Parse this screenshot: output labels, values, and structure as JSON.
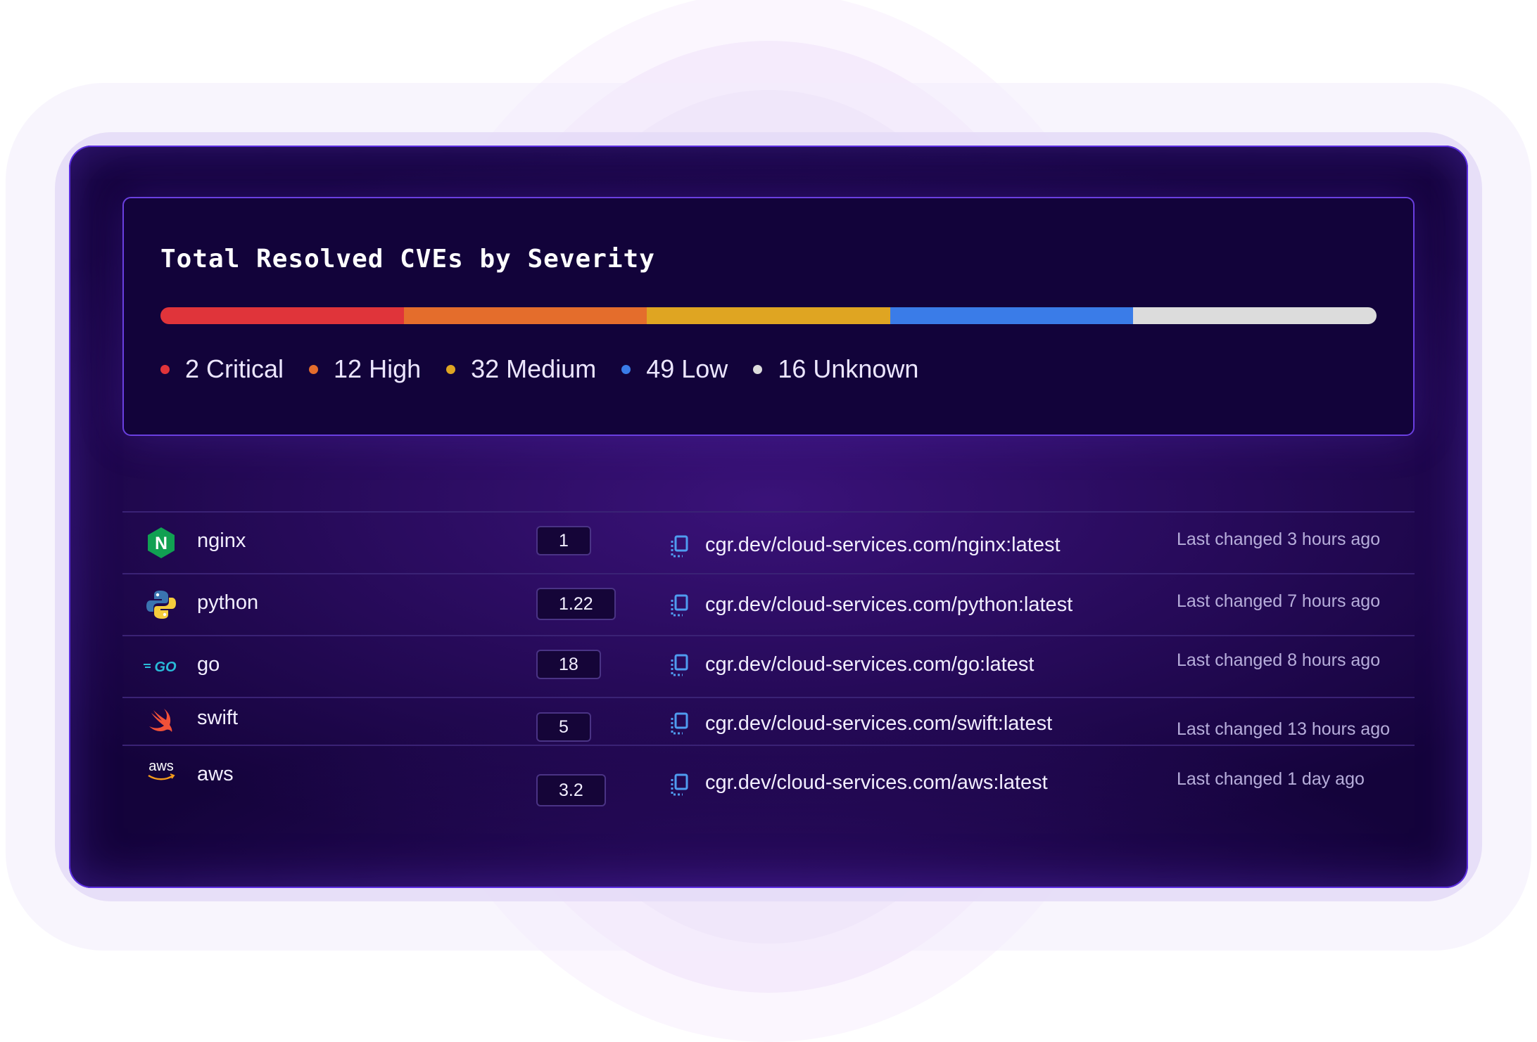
{
  "panel": {
    "title": "Total Resolved CVEs by Severity",
    "severities": [
      {
        "count": 2,
        "label": "2 Critical",
        "color": "#e0343a"
      },
      {
        "count": 12,
        "label": "12 High",
        "color": "#e46d2c"
      },
      {
        "count": 32,
        "label": "32 Medium",
        "color": "#dfa522"
      },
      {
        "count": 49,
        "label": "49 Low",
        "color": "#3a7ce8"
      },
      {
        "count": 16,
        "label": "16 Unknown",
        "color": "#dcdcdc"
      }
    ]
  },
  "repos": [
    {
      "name": "nginx",
      "version": "1",
      "url": "cgr.dev/cloud-services.com/nginx:latest",
      "last_changed": "Last changed 3 hours ago",
      "icon": "nginx-logo-icon"
    },
    {
      "name": "python",
      "version": "1.22",
      "url": "cgr.dev/cloud-services.com/python:latest",
      "last_changed": "Last changed 7 hours ago",
      "icon": "python-logo-icon"
    },
    {
      "name": "go",
      "version": "18",
      "url": "cgr.dev/cloud-services.com/go:latest",
      "last_changed": "Last changed 8 hours ago",
      "icon": "go-logo-icon"
    },
    {
      "name": "swift",
      "version": "5",
      "url": "cgr.dev/cloud-services.com/swift:latest",
      "last_changed": "Last changed 13 hours ago",
      "icon": "swift-logo-icon"
    },
    {
      "name": "aws",
      "version": "3.2",
      "url": "cgr.dev/cloud-services.com/aws:latest",
      "last_changed": "Last changed 1 day ago",
      "icon": "aws-logo-icon"
    }
  ],
  "icons": {
    "nginx_text": "N",
    "go_text": "GO",
    "aws_text": "aws"
  }
}
